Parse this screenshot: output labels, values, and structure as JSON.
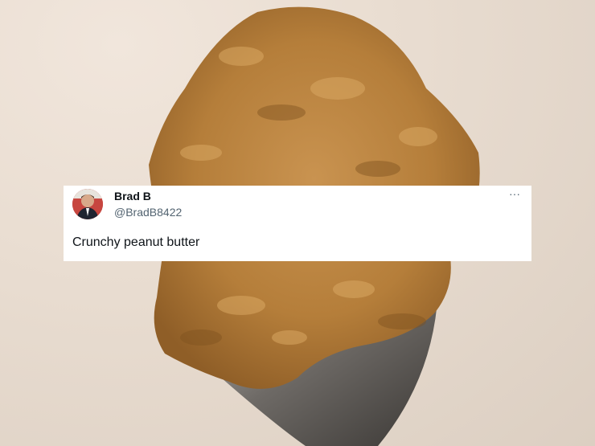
{
  "tweet": {
    "display_name": "Brad B",
    "handle": "@BradB8422",
    "text": "Crunchy peanut butter",
    "more_icon": "ellipsis-icon"
  },
  "colors": {
    "card_background": "#ffffff",
    "name_color": "#0f1419",
    "handle_color": "#536471",
    "peanut_butter": "#c08a3e"
  }
}
